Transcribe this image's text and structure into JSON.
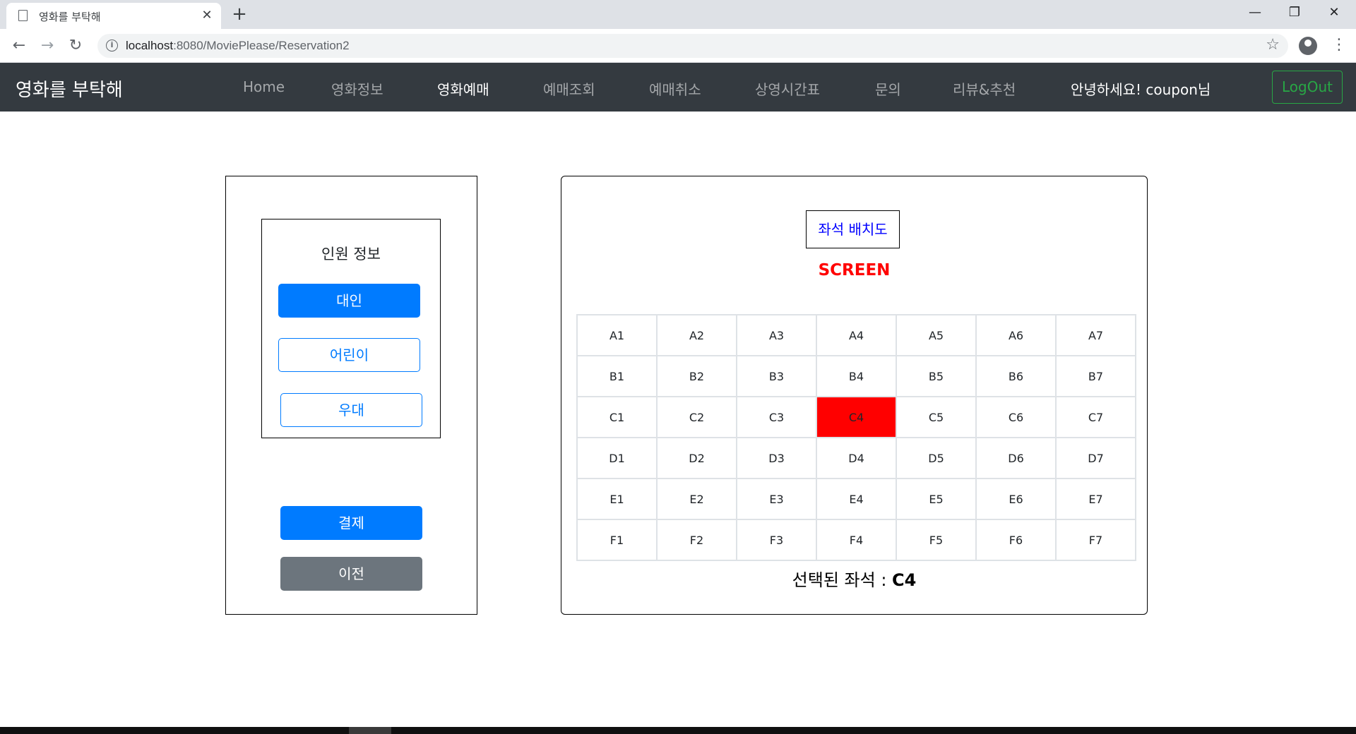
{
  "browser": {
    "tab_title": "영화를 부탁해",
    "tab_close": "✕",
    "new_tab": "+",
    "url_host": "localhost",
    "url_path": ":8080/MoviePlease/Reservation2",
    "window_controls": [
      "—",
      "❐",
      "✕"
    ]
  },
  "navbar": {
    "brand": "영화를 부탁해",
    "links": [
      "Home",
      "영화정보",
      "영화예매",
      "예매조회",
      "예매취소",
      "상영시간표",
      "문의",
      "리뷰&추천"
    ],
    "active_link": "영화예매",
    "greeting": "안녕하세요! coupon님",
    "logout": "LogOut"
  },
  "people": {
    "title": "인원 정보",
    "adult": "대인",
    "child": "어린이",
    "special": "우대"
  },
  "actions": {
    "pay": "결제",
    "prev": "이전"
  },
  "seatmap": {
    "title": "좌석 배치도",
    "screen": "SCREEN",
    "rows": [
      [
        "A1",
        "A2",
        "A3",
        "A4",
        "A5",
        "A6",
        "A7"
      ],
      [
        "B1",
        "B2",
        "B3",
        "B4",
        "B5",
        "B6",
        "B7"
      ],
      [
        "C1",
        "C2",
        "C3",
        "C4",
        "C5",
        "C6",
        "C7"
      ],
      [
        "D1",
        "D2",
        "D3",
        "D4",
        "D5",
        "D6",
        "D7"
      ],
      [
        "E1",
        "E2",
        "E3",
        "E4",
        "E5",
        "E6",
        "E7"
      ],
      [
        "F1",
        "F2",
        "F3",
        "F4",
        "F5",
        "F6",
        "F7"
      ]
    ],
    "selected_seat": "C4",
    "selected_label": "선택된 좌석 : ",
    "selected_color": "#ff0000"
  },
  "colors": {
    "primary": "#007bff",
    "secondary": "#6c757d",
    "navbar": "#343a40",
    "success": "#28a745"
  }
}
